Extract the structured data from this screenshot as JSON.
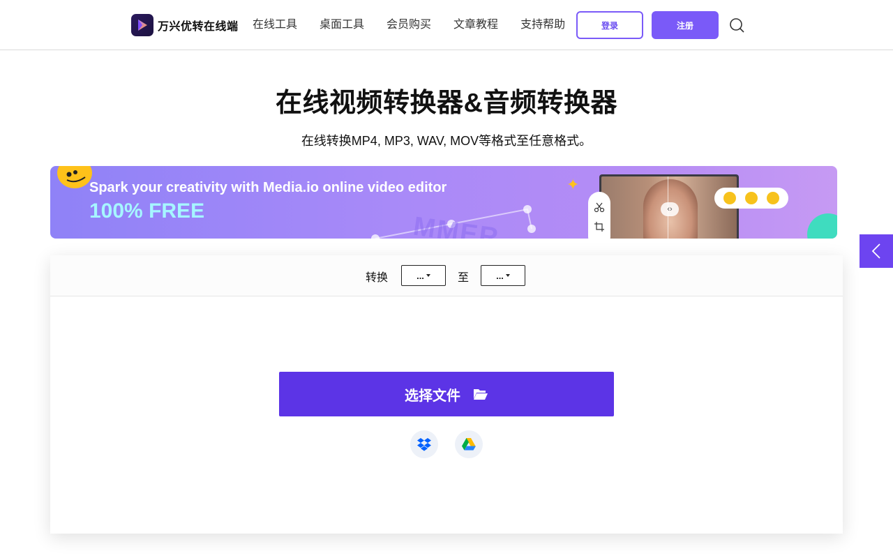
{
  "header": {
    "logo_text": "万兴优转在线端",
    "nav": [
      {
        "label": "在线工具"
      },
      {
        "label": "桌面工具"
      },
      {
        "label": "会员购买"
      },
      {
        "label": "文章教程"
      },
      {
        "label": "支持帮助"
      }
    ],
    "login_label": "登录",
    "register_label": "注册"
  },
  "hero": {
    "title": "在线视频转换器&音频转换器",
    "subtitle": "在线转换MP4, MP3, WAV, MOV等格式至任意格式。"
  },
  "banner": {
    "line1": "Spark your creativity with Media.io online video editor",
    "line2": "100% FREE",
    "deco_text": "MMER"
  },
  "converter": {
    "convert_label": "转换",
    "from_value": "...",
    "to_label": "至",
    "to_value": "...",
    "choose_file_label": "选择文件"
  },
  "colors": {
    "accent": "#7a5af8",
    "primary_button": "#5c34e6",
    "side_tab": "#6d44f0",
    "banner_highlight": "#a6f6ff"
  },
  "icons": [
    "search-icon",
    "folder-open-icon",
    "dropbox-icon",
    "google-drive-icon",
    "chevron-left-icon",
    "scissors-icon",
    "crop-icon"
  ]
}
